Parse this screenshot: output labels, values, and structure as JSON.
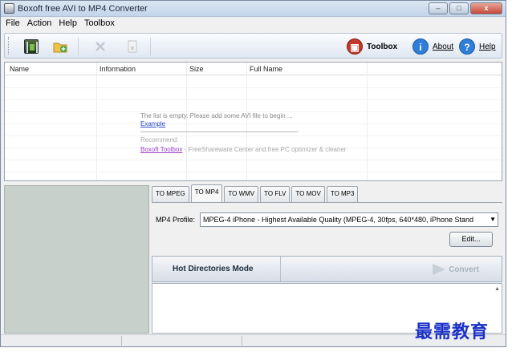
{
  "window": {
    "title": "Boxoft free AVI to MP4 Converter",
    "minimize": "–",
    "maximize": "□",
    "close": "x"
  },
  "menu": [
    "File",
    "Action",
    "Help",
    "Toolbox"
  ],
  "toolbar": {
    "toolbox_label": "Toolbox",
    "about_label": "About",
    "help_label": "Help"
  },
  "file_list": {
    "columns": [
      "Name",
      "Information",
      "Size",
      "Full Name"
    ],
    "empty_message": "The list is empty. Please add some AVI file to begin ...",
    "example_link": "Example",
    "recommend_label": "Recommend:",
    "recommend_link": "Boxoft Toolbox",
    "recommend_text": "- FreeShareware Center and free PC optimizer & cleaner"
  },
  "format_tabs": [
    "TO MPEG",
    "TO MP4",
    "TO WMV",
    "TO FLV",
    "TO MOV",
    "TO MP3"
  ],
  "active_tab": "TO MP4",
  "profile": {
    "label": "MP4 Profile:",
    "selected": "MPEG-4 iPhone - Highest Available Quality (MPEG-4, 30fps, 640*480, iPhone Stand",
    "edit_button": "Edit..."
  },
  "hot_directories": {
    "title": "Hot Directories Mode",
    "convert_label": "Convert"
  },
  "watermark": "最需教育",
  "colors": {
    "accent_blue": "#2d4bc6",
    "toolbox_red": "#c0392b",
    "about_blue": "#2f7fd8",
    "help_blue": "#2f7fd8"
  }
}
